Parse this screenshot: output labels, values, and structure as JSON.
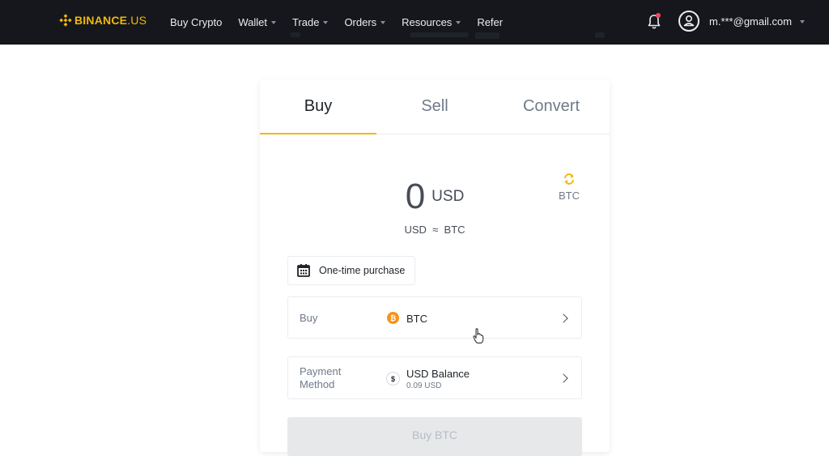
{
  "brand": {
    "name": "BINANCE",
    "suffix": ".US"
  },
  "nav": {
    "items": [
      {
        "label": "Buy Crypto",
        "dropdown": false
      },
      {
        "label": "Wallet",
        "dropdown": true
      },
      {
        "label": "Trade",
        "dropdown": true
      },
      {
        "label": "Orders",
        "dropdown": true
      },
      {
        "label": "Resources",
        "dropdown": true
      },
      {
        "label": "Refer",
        "dropdown": false
      }
    ],
    "user_email": "m.***@gmail.com"
  },
  "tabs": [
    {
      "label": "Buy",
      "active": true
    },
    {
      "label": "Sell",
      "active": false
    },
    {
      "label": "Convert",
      "active": false
    }
  ],
  "amount": {
    "value": "0",
    "unit": "USD"
  },
  "swap": {
    "label": "BTC"
  },
  "rate": {
    "from": "USD",
    "approx": "≈",
    "to": "BTC"
  },
  "frequency": {
    "label": "One-time purchase"
  },
  "buy_row": {
    "label": "Buy",
    "asset": "BTC",
    "asset_icon": "bitcoin-icon"
  },
  "payment_row": {
    "label": "Payment Method",
    "method": "USD Balance",
    "balance": "0.09 USD",
    "method_icon": "dollar-coin-icon"
  },
  "submit": {
    "label": "Buy BTC",
    "enabled": false
  },
  "colors": {
    "accent": "#f0b90b",
    "topbar": "#15171c",
    "bitcoin": "#f7931a",
    "alert": "#f6465d"
  }
}
